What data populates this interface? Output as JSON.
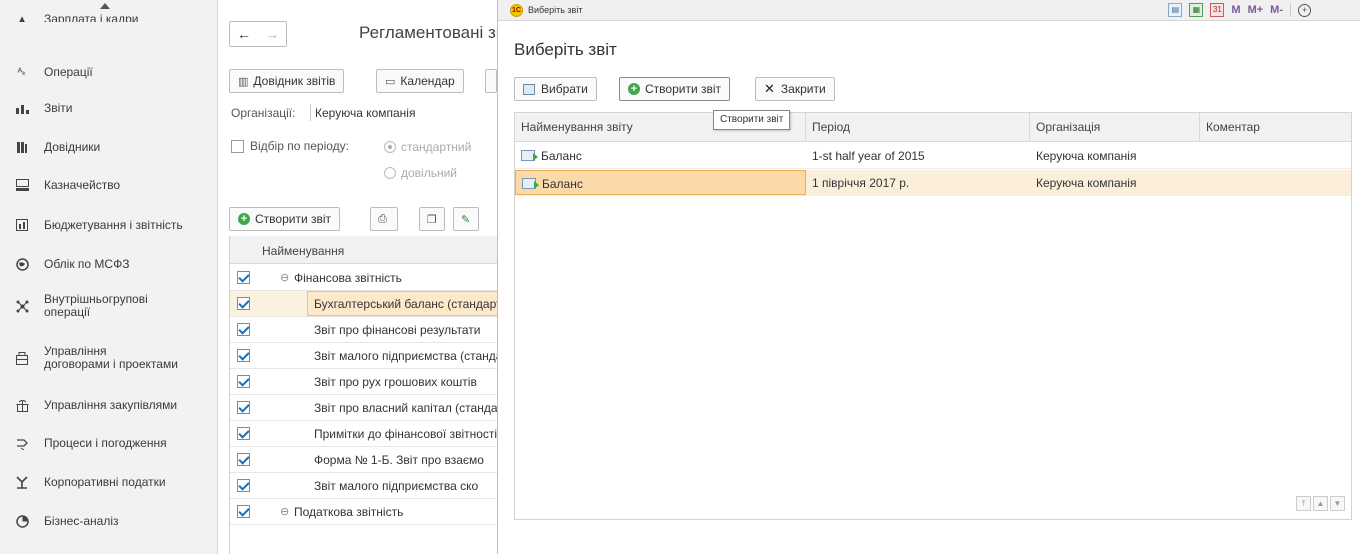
{
  "sidebar": {
    "items": [
      {
        "label": "Зарплата і кадри",
        "icon": "people-icon"
      },
      {
        "label": "Операції",
        "icon": "operations-icon"
      },
      {
        "label": "Звіти",
        "icon": "bar-chart-icon"
      },
      {
        "label": "Довідники",
        "icon": "books-icon"
      },
      {
        "label": "Казначейство",
        "icon": "cash-register-icon"
      },
      {
        "label": "Бюджетування і звітність",
        "icon": "budget-icon"
      },
      {
        "label": "Облік по МСФЗ",
        "icon": "globe-icon"
      },
      {
        "label": "Внутрішньогрупові",
        "label2": "операції",
        "icon": "network-icon"
      },
      {
        "label": "Управління",
        "label2": "договорами і проектами",
        "icon": "contract-icon"
      },
      {
        "label": "Управління закупівлями",
        "icon": "purchase-icon"
      },
      {
        "label": "Процеси і погодження",
        "icon": "process-icon"
      },
      {
        "label": "Корпоративні податки",
        "icon": "tax-icon"
      },
      {
        "label": "Бізнес-аналіз",
        "icon": "analysis-icon"
      }
    ]
  },
  "main": {
    "back_symbol": "←",
    "forward_symbol": "→",
    "title": "Регламентовані звіти",
    "btn_directory": "Довідник звітів",
    "btn_calendar": "Календар",
    "org_label": "Організації:",
    "org_value": "Керуюча компанія",
    "period_filter_label": "Відбір по періоду:",
    "radio_standard": "стандартний",
    "radio_custom": "довільний",
    "btn_create": "Створити звіт",
    "table_header": "Найменування",
    "rows": [
      {
        "group_marker": "⊖",
        "text": "Фінансова звітність",
        "group": true
      },
      {
        "text": "Бухгалтерський баланс (стандарт)"
      },
      {
        "text": "Звіт про фінансові результати"
      },
      {
        "text": "Звіт малого підприємства (стандарт)"
      },
      {
        "text": "Звіт про рух грошових коштів"
      },
      {
        "text": "Звіт про власний капітал (стандарт)"
      },
      {
        "text": "Примітки до фінансової звітності"
      },
      {
        "text": "Форма № 1-Б. Звіт про взаємо"
      },
      {
        "text": "Звіт малого підприємства ско"
      },
      {
        "group_marker": "⊖",
        "text": "Податкова звітність",
        "group": true
      }
    ]
  },
  "modal": {
    "window_title": "Виберіть звіт",
    "heading": "Виберіть звіт",
    "toolbar_m": "M",
    "toolbar_mplus": "M+",
    "toolbar_mminus": "M-",
    "zoom_symbol": "+",
    "btn_select": "Вибрати",
    "btn_create": "Створити звіт",
    "btn_close": "Закрити",
    "tooltip": "Створити звіт",
    "columns": [
      "Найменування звіту",
      "Період",
      "Організація",
      "Коментар"
    ],
    "rows": [
      {
        "name": "Баланс",
        "period": "1-st half year of 2015",
        "org": "Керуюча компанія",
        "comment": ""
      },
      {
        "name": "Баланс",
        "period": "1 півріччя 2017 р.",
        "org": "Керуюча компанія",
        "comment": ""
      }
    ]
  },
  "colors": {
    "selection": "#fbd9a8",
    "selection_row": "#fbefdc",
    "accent_green": "#3ea84b",
    "sidebar_bg": "#f2f2f2"
  }
}
